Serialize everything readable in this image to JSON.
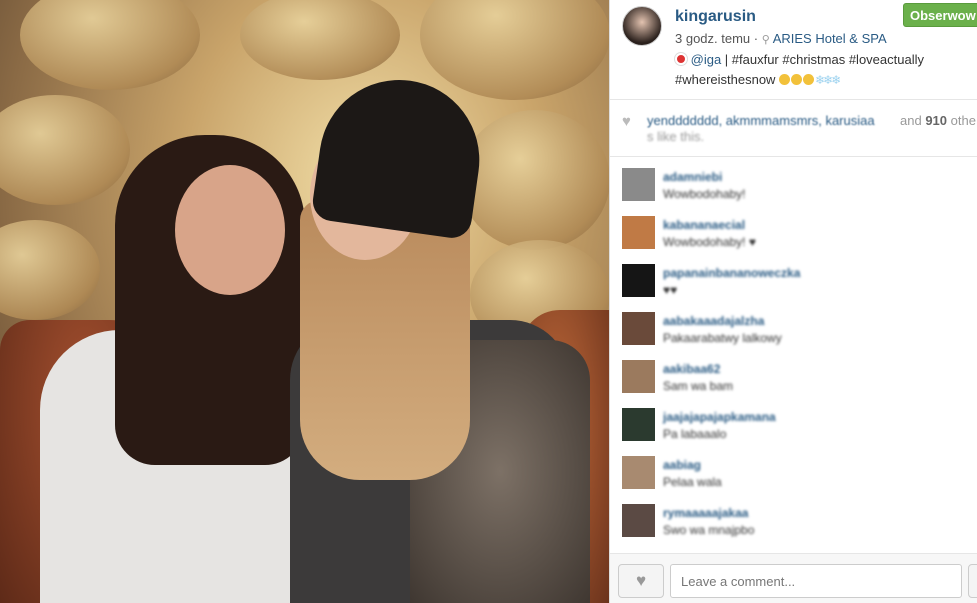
{
  "post": {
    "username": "kingarusin",
    "follow_label": "Obserwow",
    "time": "3 godz. temu",
    "location": "ARIES Hotel & SPA",
    "caption_mention": "@iga",
    "caption_tags_1": "| #fauxfur #christmas #loveactually",
    "caption_tags_2": "#whereisthesnow"
  },
  "likes": {
    "likers": "yenddddddd, akmmmamsmrs, karusiaa",
    "and_label": "and",
    "count": "910",
    "suffix": "othe",
    "line2": "s like this."
  },
  "comments": [
    {
      "user": "adamniebi",
      "text": "Wowbodohaby!",
      "avatar": "#8a8a8a"
    },
    {
      "user": "kabananaecial",
      "text": "Wowbodohaby! ♥",
      "avatar": "#c07a45"
    },
    {
      "user": "papanainbananoweczka",
      "text": "♥♥",
      "avatar": "#151515"
    },
    {
      "user": "aabakaaadajalzha",
      "text": "Pakaarabatwy lalkowy",
      "avatar": "#6a4a3a"
    },
    {
      "user": "aakibaa62",
      "text": "Sam wa bam",
      "avatar": "#9b7a5e"
    },
    {
      "user": "jaajajapajapkamana",
      "text": "Pa labaaalo",
      "avatar": "#2b3a2f"
    },
    {
      "user": "aabiag",
      "text": "Pelaa wala",
      "avatar": "#a88a70"
    },
    {
      "user": "rymaaaaajakaa",
      "text": "Swo wa mnajpbo",
      "avatar": "#5b4a44"
    }
  ],
  "footer": {
    "comment_placeholder": "Leave a comment..."
  },
  "colors": {
    "link": "#2a5b84",
    "follow_bg": "#6bb04b"
  },
  "icons": {
    "heart": "heart-icon",
    "pin": "location-pin-icon"
  }
}
